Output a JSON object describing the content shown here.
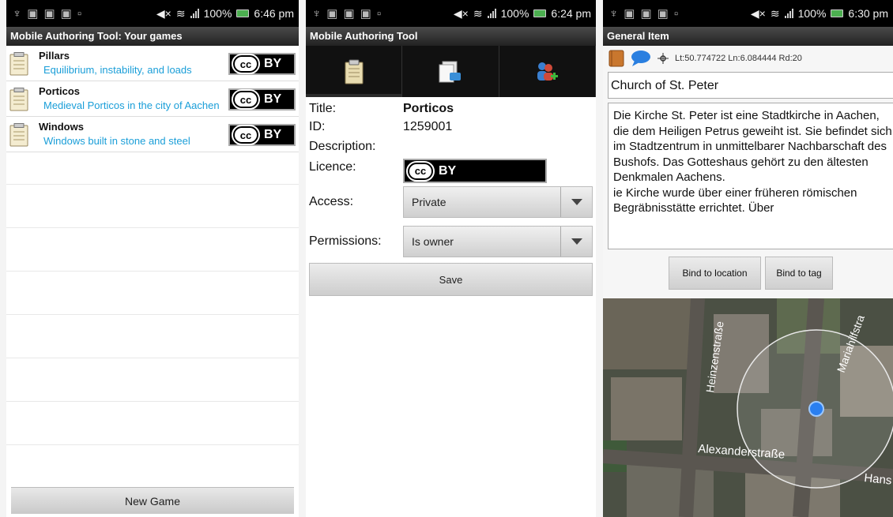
{
  "status": {
    "panel1_time": "6:46 pm",
    "panel2_time": "6:24 pm",
    "panel3_time": "6:30 pm",
    "battery": "100%"
  },
  "panel1": {
    "title": "Mobile Authoring Tool: Your games",
    "games": [
      {
        "title": "Pillars",
        "description": "Equilibrium, instability, and loads"
      },
      {
        "title": "Porticos",
        "description": "Medieval Porticos in the city of Aachen"
      },
      {
        "title": "Windows",
        "description": "Windows built in stone and steel"
      }
    ],
    "license_badge": {
      "cc": "cc",
      "by": "BY"
    },
    "new_game_label": "New Game"
  },
  "panel2": {
    "title": "Mobile Authoring Tool",
    "tabs": [
      {
        "icon": "clipboard-icon"
      },
      {
        "icon": "document-export-icon"
      },
      {
        "icon": "add-users-icon"
      }
    ],
    "fields": {
      "title_label": "Title:",
      "title_value": "Porticos",
      "id_label": "ID:",
      "id_value": "1259001",
      "description_label": "Description:",
      "licence_label": "Licence:",
      "access_label": "Access:",
      "access_value": "Private",
      "permissions_label": "Permissions:",
      "permissions_value": "Is owner"
    },
    "save_label": "Save"
  },
  "panel3": {
    "title": "General Item",
    "coordinates": "Lt:50.774722 Ln:6.084444 Rd:20",
    "name_value": "Church of St. Peter",
    "description_value": "Die Kirche St. Peter ist eine Stadtkirche in Aachen, die dem Heiligen Petrus geweiht ist. Sie befindet sich im Stadtzentrum in unmittelbarer Nachbarschaft des Bushofs. Das Gotteshaus gehört zu den ältesten Denkmalen Aachens.\nie Kirche wurde über einer früheren römischen Begräbnisstätte errichtet. Über",
    "bind_location_label": "Bind to location",
    "bind_tag_label": "Bind to tag",
    "map_labels": {
      "street1": "Heinzenstraße",
      "street2": "Mariahilfstra",
      "street3": "Alexanderstraße",
      "street4": "Hans"
    }
  }
}
